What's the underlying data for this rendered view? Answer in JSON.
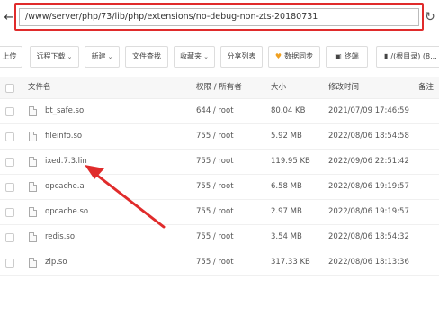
{
  "path": {
    "back_glyph": "←",
    "value": "/www/server/php/73/lib/php/extensions/no-debug-non-zts-20180731",
    "refresh_glyph": "↻"
  },
  "toolbar": {
    "upload": "上传",
    "remote_download": "远程下载",
    "new": "新建",
    "file_search": "文件查找",
    "favorites": "收藏夹",
    "share_list": "分享列表",
    "data_sync": "数据同步",
    "terminal": "终端",
    "root_dir": "/(根目录) (8..."
  },
  "table": {
    "columns": [
      "文件名",
      "权限 / 所有者",
      "大小",
      "修改时间",
      "备注"
    ],
    "rows": [
      {
        "name": "bt_safe.so",
        "perm": "644 / root",
        "size": "80.04 KB",
        "mtime": "2021/07/09 17:46:59"
      },
      {
        "name": "fileinfo.so",
        "perm": "755 / root",
        "size": "5.92 MB",
        "mtime": "2022/08/06 18:54:58"
      },
      {
        "name": "ixed.7.3.lin",
        "perm": "755 / root",
        "size": "119.95 KB",
        "mtime": "2022/09/06 22:51:42"
      },
      {
        "name": "opcache.a",
        "perm": "755 / root",
        "size": "6.58 MB",
        "mtime": "2022/08/06 19:19:57"
      },
      {
        "name": "opcache.so",
        "perm": "755 / root",
        "size": "2.97 MB",
        "mtime": "2022/08/06 19:19:57"
      },
      {
        "name": "redis.so",
        "perm": "755 / root",
        "size": "3.54 MB",
        "mtime": "2022/08/06 18:54:32"
      },
      {
        "name": "zip.so",
        "perm": "755 / root",
        "size": "317.33 KB",
        "mtime": "2022/08/06 18:13:36"
      }
    ]
  },
  "colors": {
    "annotation_red": "#e02b2b",
    "data_sync_icon": "#f0a020"
  }
}
